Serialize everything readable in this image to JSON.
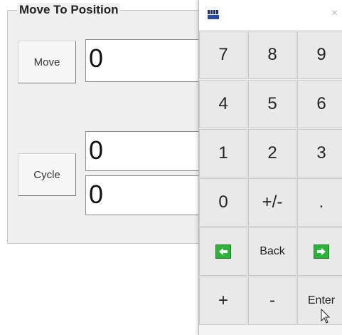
{
  "group": {
    "title": "Move To Position",
    "move_label": "Move",
    "move_value": "0",
    "cycle_label": "Cycle",
    "cycle_value_1": "0",
    "cycle_value_2": "0"
  },
  "keypad": {
    "close_glyph": "×",
    "keys": {
      "k7": "7",
      "k8": "8",
      "k9": "9",
      "k4": "4",
      "k5": "5",
      "k6": "6",
      "k1": "1",
      "k2": "2",
      "k3": "3",
      "k0": "0",
      "plusminus": "+/-",
      "dot": ".",
      "back": "Back",
      "plus": "+",
      "minus": "-",
      "enter": "Enter"
    },
    "left_arrow_icon": "arrow-left-icon",
    "right_arrow_icon": "arrow-right-icon"
  },
  "colors": {
    "arrow_green": "#2eb33a"
  }
}
